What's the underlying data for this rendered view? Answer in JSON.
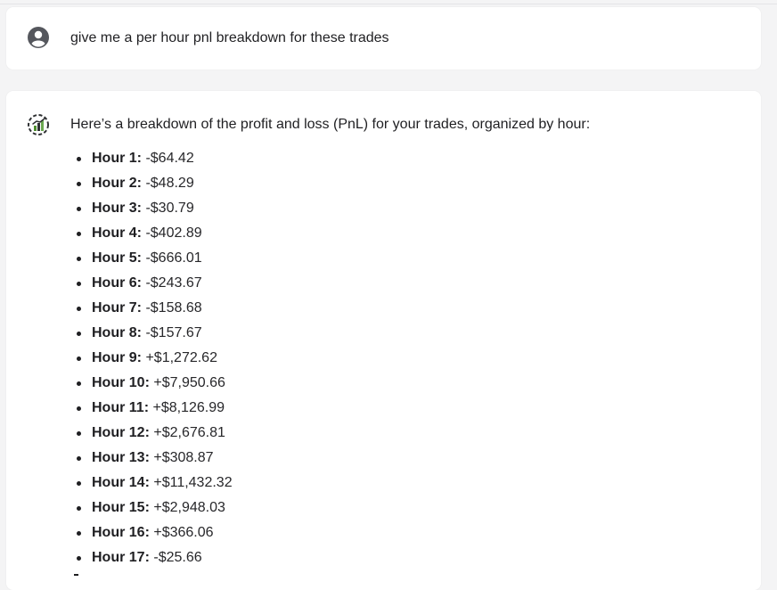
{
  "user_message": {
    "avatar_icon": "user-circle-icon",
    "text": "give me a per hour pnl breakdown for these trades"
  },
  "assistant_message": {
    "avatar_icon": "bot-chart-icon",
    "intro": "Here’s a breakdown of the profit and loss (PnL) for your trades, organized by hour:",
    "items": [
      {
        "label": "Hour 1:",
        "value": "-$64.42"
      },
      {
        "label": "Hour 2:",
        "value": "-$48.29"
      },
      {
        "label": "Hour 3:",
        "value": "-$30.79"
      },
      {
        "label": "Hour 4:",
        "value": "-$402.89"
      },
      {
        "label": "Hour 5:",
        "value": "-$666.01"
      },
      {
        "label": "Hour 6:",
        "value": "-$243.67"
      },
      {
        "label": "Hour 7:",
        "value": "-$158.68"
      },
      {
        "label": "Hour 8:",
        "value": "-$157.67"
      },
      {
        "label": "Hour 9:",
        "value": "+$1,272.62"
      },
      {
        "label": "Hour 10:",
        "value": "+$7,950.66"
      },
      {
        "label": "Hour 11:",
        "value": "+$8,126.99"
      },
      {
        "label": "Hour 12:",
        "value": "+$2,676.81"
      },
      {
        "label": "Hour 13:",
        "value": "+$308.87"
      },
      {
        "label": "Hour 14:",
        "value": "+$11,432.32"
      },
      {
        "label": "Hour 15:",
        "value": "+$2,948.03"
      },
      {
        "label": "Hour 16:",
        "value": "+$366.06"
      },
      {
        "label": "Hour 17:",
        "value": "-$25.66"
      }
    ]
  }
}
